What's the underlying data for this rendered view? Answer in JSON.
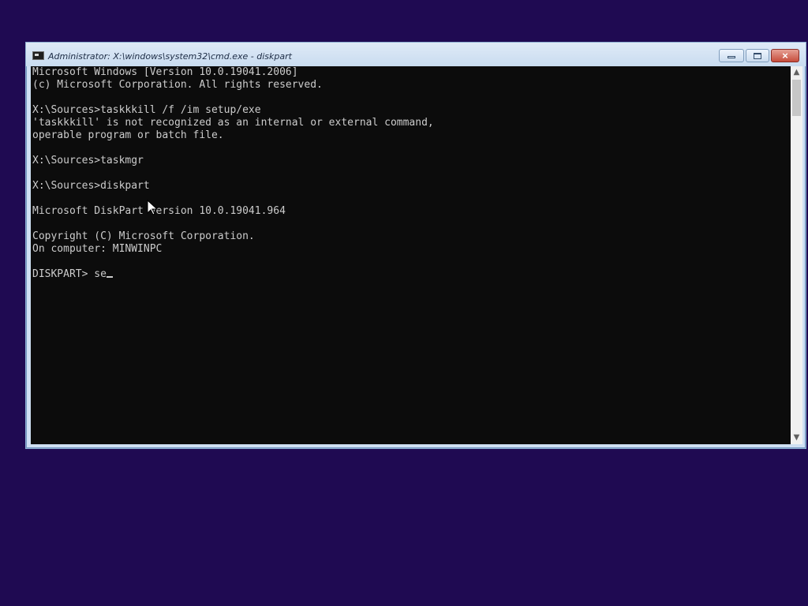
{
  "window": {
    "title": "Administrator: X:\\windows\\system32\\cmd.exe - diskpart",
    "controls": {
      "close_label": "×"
    }
  },
  "terminal": {
    "lines": [
      "Microsoft Windows [Version 10.0.19041.2006]",
      "(c) Microsoft Corporation. All rights reserved.",
      "",
      "X:\\Sources>taskkkill /f /im setup/exe",
      "'taskkkill' is not recognized as an internal or external command,",
      "operable program or batch file.",
      "",
      "X:\\Sources>taskmgr",
      "",
      "X:\\Sources>diskpart",
      "",
      "Microsoft DiskPart version 10.0.19041.964",
      "",
      "Copyright (C) Microsoft Corporation.",
      "On computer: MINWINPC",
      "",
      "DISKPART> se"
    ]
  },
  "scrollbar": {
    "up_arrow": "▲",
    "down_arrow": "▼"
  },
  "colors": {
    "desktop": "#1f0a52",
    "terminal_bg": "#0c0c0c",
    "terminal_fg": "#cccccc",
    "close_button": "#c74d3c"
  },
  "icons": {
    "title": "cmd-icon",
    "pointer": "mouse-pointer-icon"
  }
}
